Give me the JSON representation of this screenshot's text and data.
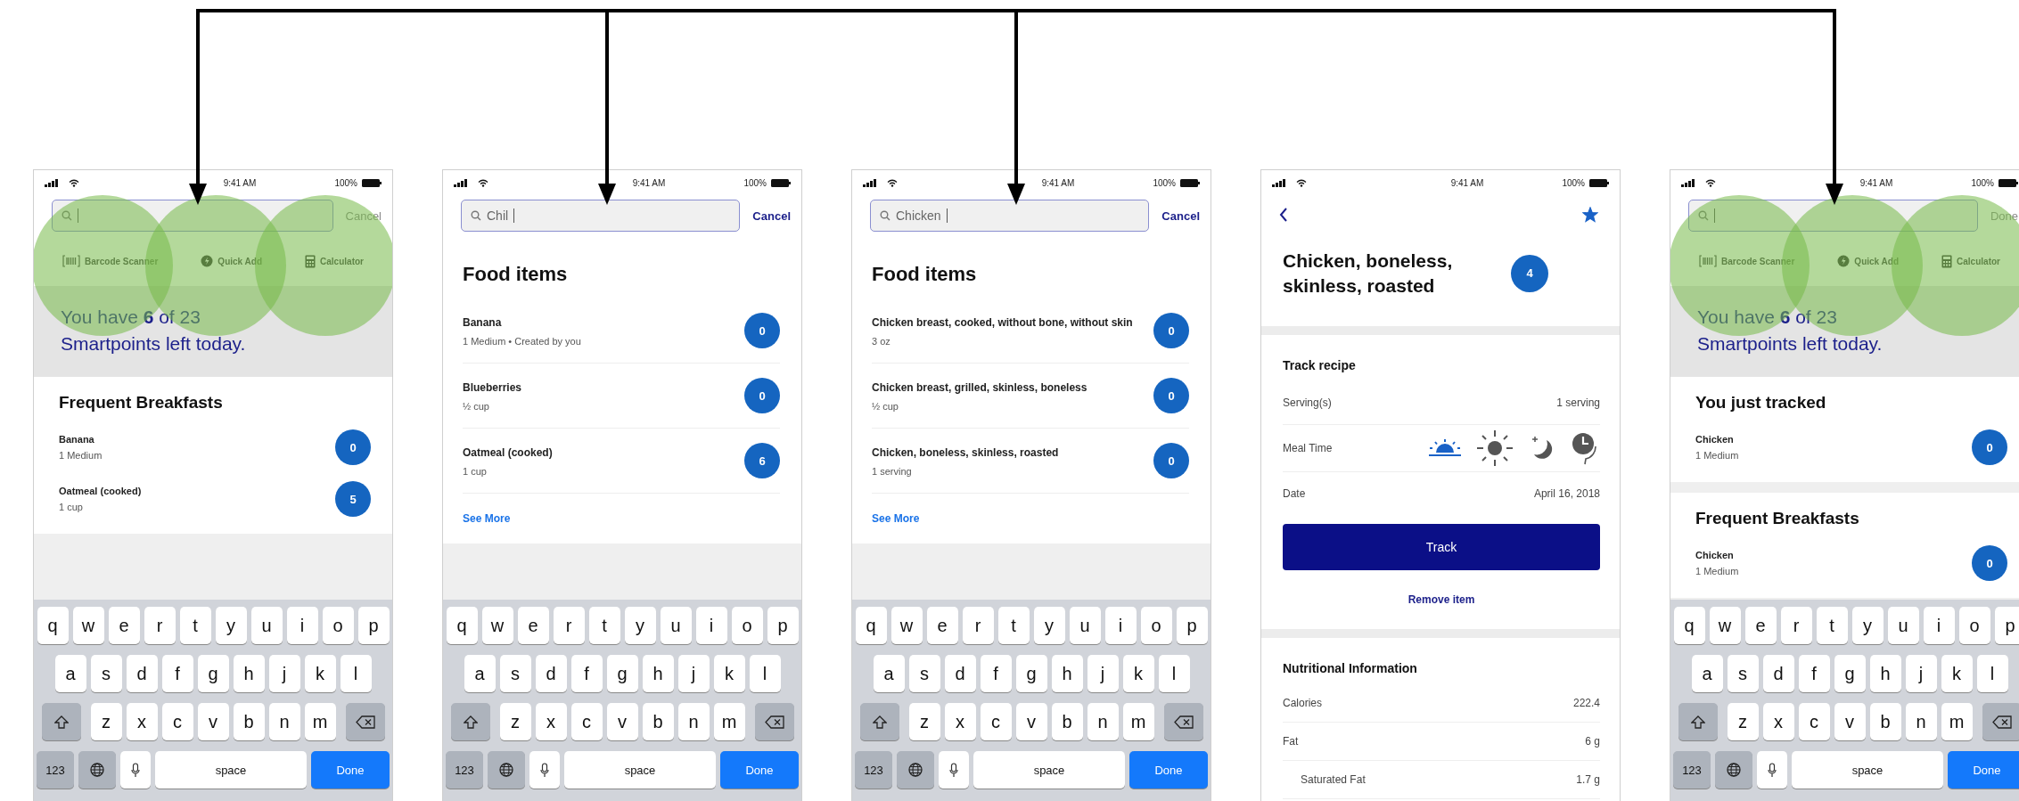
{
  "screens": [
    {
      "kind": "search_home",
      "arrow_in": true,
      "highlighted": true,
      "status": {
        "time": "9:41 AM",
        "battery": "100%"
      },
      "search": {
        "action": "Cancel",
        "action_disabled": true
      },
      "shortcuts": [
        {
          "kind": "barcode",
          "label": "Barcode Scanner"
        },
        {
          "kind": "quick",
          "label": "Quick Add"
        },
        {
          "kind": "calc",
          "label": "Calculator"
        }
      ],
      "points_message": "You have **6** of 23 Smartpoints left today.",
      "sections": [
        {
          "title": "Frequent Breakfasts",
          "items": [
            {
              "name": "Banana",
              "detail": "1 Medium",
              "points": "0"
            },
            {
              "name": "Oatmeal (cooked)",
              "detail": "1 cup",
              "points": "5"
            }
          ]
        }
      ],
      "keyboard": {
        "rows": [
          [
            "q",
            "w",
            "e",
            "r",
            "t",
            "y",
            "u",
            "i",
            "o",
            "p"
          ],
          [
            "a",
            "s",
            "d",
            "f",
            "g",
            "h",
            "j",
            "k",
            "l"
          ],
          [
            "z",
            "x",
            "c",
            "v",
            "b",
            "n",
            "m"
          ]
        ],
        "numbers": "123",
        "space": "space",
        "done": "Done"
      }
    },
    {
      "kind": "search_results",
      "arrow_in": true,
      "highlighted": false,
      "status": {
        "time": "9:41 AM",
        "battery": "100%"
      },
      "search": {
        "value": "Chil",
        "action": "Cancel",
        "action_disabled": false
      },
      "results": {
        "heading": "Food items",
        "items": [
          {
            "name": "Banana",
            "detail": "1 Medium • Created by you",
            "points": "0"
          },
          {
            "name": "Blueberries",
            "detail": "½ cup",
            "points": "0"
          },
          {
            "name": "Oatmeal (cooked)",
            "detail": "1 cup",
            "points": "6"
          }
        ],
        "see_more": "See More"
      },
      "keyboard": {
        "rows": [
          [
            "q",
            "w",
            "e",
            "r",
            "t",
            "y",
            "u",
            "i",
            "o",
            "p"
          ],
          [
            "a",
            "s",
            "d",
            "f",
            "g",
            "h",
            "j",
            "k",
            "l"
          ],
          [
            "z",
            "x",
            "c",
            "v",
            "b",
            "n",
            "m"
          ]
        ],
        "numbers": "123",
        "space": "space",
        "done": "Done"
      }
    },
    {
      "kind": "search_results",
      "arrow_in": true,
      "highlighted": false,
      "status": {
        "time": "9:41 AM",
        "battery": "100%"
      },
      "search": {
        "value": "Chicken",
        "action": "Cancel",
        "action_disabled": false
      },
      "results": {
        "heading": "Food items",
        "items": [
          {
            "name": "Chicken breast, cooked, without bone, without skin",
            "detail": "3 oz",
            "points": "0"
          },
          {
            "name": "Chicken breast, grilled, skinless, boneless",
            "detail": "½ cup",
            "points": "0"
          },
          {
            "name": "Chicken, boneless, skinless, roasted",
            "detail": "1 serving",
            "points": "0"
          }
        ],
        "see_more": "See More"
      },
      "keyboard": {
        "rows": [
          [
            "q",
            "w",
            "e",
            "r",
            "t",
            "y",
            "u",
            "i",
            "o",
            "p"
          ],
          [
            "a",
            "s",
            "d",
            "f",
            "g",
            "h",
            "j",
            "k",
            "l"
          ],
          [
            "z",
            "x",
            "c",
            "v",
            "b",
            "n",
            "m"
          ]
        ],
        "numbers": "123",
        "space": "space",
        "done": "Done"
      }
    },
    {
      "kind": "detail",
      "arrow_in": false,
      "highlighted": false,
      "status": {
        "time": "9:41 AM",
        "battery": "100%"
      },
      "detail": {
        "title": "Chicken, boneless, skinless, roasted",
        "points": "4",
        "favorite": true,
        "track": {
          "heading": "Track recipe",
          "rows": [
            {
              "kind": "text",
              "label": "Serving(s)",
              "value": "1 serving"
            },
            {
              "kind": "meal",
              "label": "Meal Time",
              "meals": [
                {
                  "kind": "morning",
                  "selected": true
                },
                {
                  "kind": "midday",
                  "selected": false
                },
                {
                  "kind": "evening",
                  "selected": false
                },
                {
                  "kind": "anytime",
                  "selected": false
                }
              ]
            },
            {
              "kind": "text",
              "label": "Date",
              "value": "April 16, 2018"
            }
          ],
          "button": "Track",
          "remove": "Remove item"
        },
        "nutrition": {
          "heading": "Nutritional Information",
          "rows": [
            {
              "label": "Calories",
              "value": "222.4",
              "sub": false
            },
            {
              "label": "Fat",
              "value": "6 g",
              "sub": false
            },
            {
              "label": "Saturated Fat",
              "value": "1.7 g",
              "sub": true
            }
          ]
        }
      }
    },
    {
      "kind": "search_home",
      "arrow_in": true,
      "highlighted": true,
      "status": {
        "time": "9:41 AM",
        "battery": "100%"
      },
      "search": {
        "action": "Done",
        "action_disabled": true
      },
      "shortcuts": [
        {
          "kind": "barcode",
          "label": "Barcode Scanner"
        },
        {
          "kind": "quick",
          "label": "Quick Add"
        },
        {
          "kind": "calc",
          "label": "Calculator"
        }
      ],
      "points_message": "You have **6** of 23 Smartpoints left today.",
      "sections": [
        {
          "title": "You just tracked",
          "items": [
            {
              "name": "Chicken",
              "detail": "1 Medium",
              "points": "0"
            }
          ]
        },
        {
          "title": "Frequent Breakfasts",
          "items": [
            {
              "name": "Chicken",
              "detail": "1 Medium",
              "points": "0"
            }
          ]
        }
      ],
      "keyboard": {
        "rows": [
          [
            "q",
            "w",
            "e",
            "r",
            "t",
            "y",
            "u",
            "i",
            "o",
            "p"
          ],
          [
            "a",
            "s",
            "d",
            "f",
            "g",
            "h",
            "j",
            "k",
            "l"
          ],
          [
            "z",
            "x",
            "c",
            "v",
            "b",
            "n",
            "m"
          ]
        ],
        "numbers": "123",
        "space": "space",
        "done": "Done"
      }
    }
  ]
}
